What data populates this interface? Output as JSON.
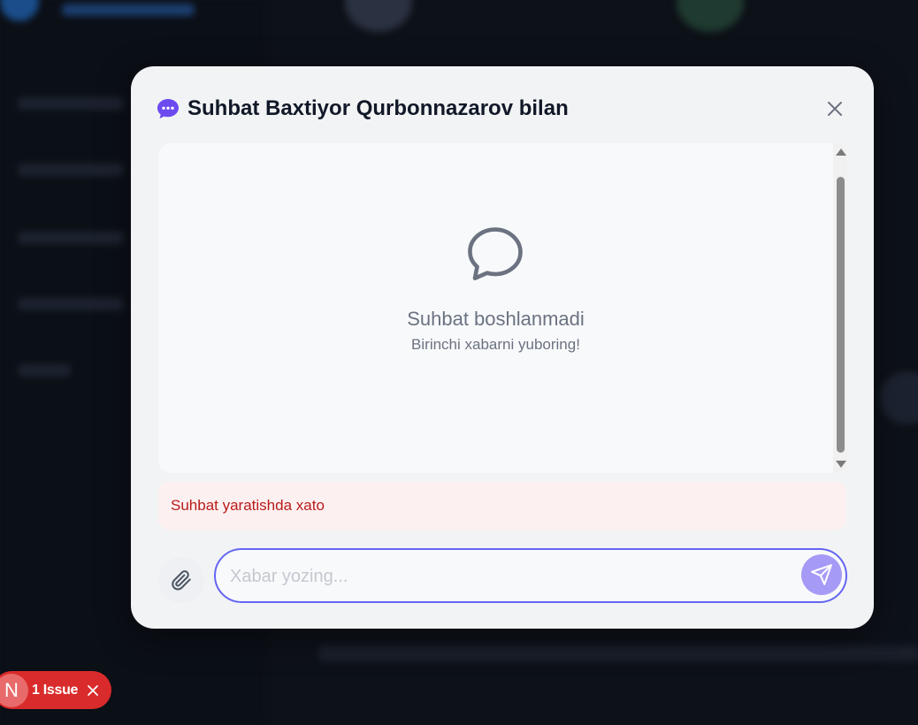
{
  "modal": {
    "title": "Suhbat Baxtiyor Qurbonnazarov bilan",
    "empty_title": "Suhbat boshlanmadi",
    "empty_subtitle": "Birinchi xabarni yuboring!",
    "error_text": "Suhbat yaratishda xato",
    "input_placeholder": "Xabar yozing...",
    "input_value": ""
  },
  "issue_badge": {
    "logo_letter": "N",
    "label": "1 Issue"
  },
  "icons": {
    "chat": "chat-bubble-dots-icon",
    "close": "close-icon",
    "empty_chat": "chat-bubble-outline-icon",
    "attach": "paperclip-icon",
    "send": "send-icon"
  },
  "colors": {
    "accent": "#6366f1",
    "send_button": "#a59af5",
    "error_text": "#b91c1c",
    "error_bg": "#fdf0f0",
    "issue_red": "#d92b2b"
  }
}
